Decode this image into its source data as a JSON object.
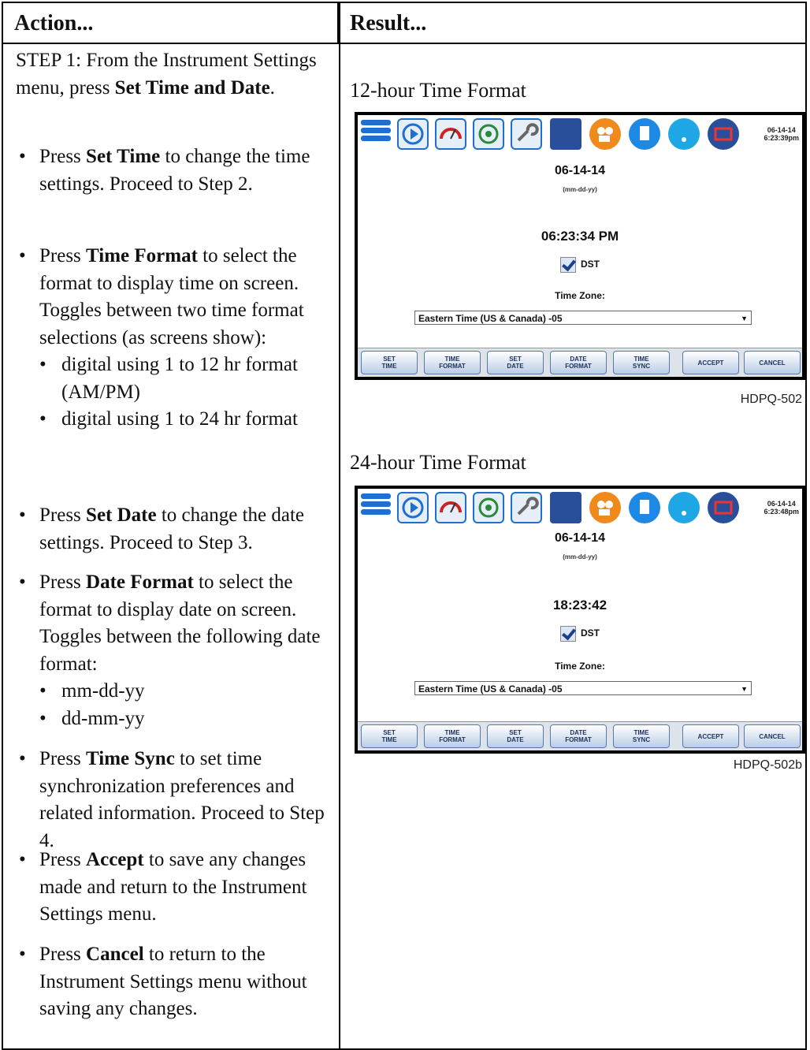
{
  "header": {
    "action": "Action...",
    "result": "Result..."
  },
  "step": {
    "prefix": "STEP 1: From the Instrument Settings menu, press ",
    "bold": "Set Time and Date",
    "suffix": "."
  },
  "bullets": [
    {
      "pre": "Press ",
      "bold": "Set Time",
      "post": " to change the time settings. Proceed to Step 2."
    },
    {
      "pre": "Press ",
      "bold": "Time Format",
      "post": " to select the format to display time on screen. Toggles between two time format selections (as screens show):",
      "subs": [
        "digital using 1 to 12 hr format (AM/PM)",
        "digital using 1 to 24 hr format"
      ]
    },
    {
      "pre": "Press ",
      "bold": "Set Date",
      "post": " to change the date settings. Proceed to Step 3."
    },
    {
      "pre": "Press ",
      "bold": "Date Format",
      "post": " to select the format to display date on screen. Toggles between the following date format:",
      "subs": [
        "mm-dd-yy",
        "dd-mm-yy"
      ]
    },
    {
      "pre": "Press ",
      "bold": "Time Sync",
      "post": " to set time synchronization preferences and related information. Proceed to Step 4."
    },
    {
      "pre": "Press ",
      "bold": "Accept",
      "post": " to save any changes made and return to the Instrument Settings menu."
    },
    {
      "pre": "Press ",
      "bold": "Cancel",
      "post": " to return to the Instrument Settings menu without saving any changes."
    }
  ],
  "screens": [
    {
      "label": "12-hour Time Format",
      "clock_date": "06-14-14",
      "clock_time": "6:23:39pm",
      "date": "06-14-14",
      "date_format": "(mm-dd-yy)",
      "time": "06:23:34 PM",
      "dst": "DST",
      "tz_label": "Time Zone:",
      "tz_value": "Eastern Time (US & Canada) -05",
      "code": "HDPQ-502"
    },
    {
      "label": "24-hour Time Format",
      "clock_date": "06-14-14",
      "clock_time": "6:23:48pm",
      "date": "06-14-14",
      "date_format": "(mm-dd-yy)",
      "time": "18:23:42",
      "dst": "DST",
      "tz_label": "Time Zone:",
      "tz_value": "Eastern Time (US & Canada) -05",
      "code": "HDPQ-502b"
    }
  ],
  "softkeys": [
    "SET\nTIME",
    "TIME\nFORMAT",
    "SET\nDATE",
    "DATE\nFORMAT",
    "TIME\nSYNC",
    "ACCEPT",
    "CANCEL"
  ],
  "toolbar_icons": [
    "menu-icon",
    "play-icon",
    "gauge-icon",
    "eye-icon",
    "wrench-icon",
    "screen-icon",
    "camera-icon",
    "document-icon",
    "wireless-icon",
    "battery-icon"
  ],
  "colors": {
    "toolbar_blue": "#1e6fd0",
    "orange": "#f08a1c",
    "softkey_text": "#1b2f5c"
  }
}
